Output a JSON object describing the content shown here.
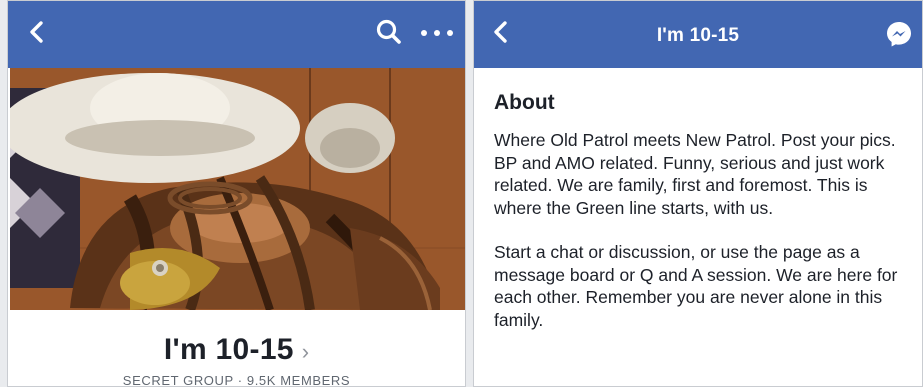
{
  "left_screen": {
    "navbar": {
      "back_icon": "chevron-left-icon",
      "search_icon": "search-icon",
      "more_icon": "more-horizontal-icon",
      "color": "#4267b2"
    },
    "cover_photo": {
      "subject": "saddle-photo"
    },
    "group": {
      "name": "I'm 10-15",
      "chevron": "›",
      "meta": "SECRET GROUP · 9.5K MEMBERS"
    }
  },
  "right_screen": {
    "navbar": {
      "back_icon": "chevron-left-icon",
      "title": "I'm 10-15",
      "messenger_icon": "messenger-icon",
      "color": "#4267b2"
    },
    "about": {
      "heading": "About",
      "paragraphs": [
        "Where Old Patrol meets New Patrol. Post your pics. BP and AMO related. Funny, serious and just work related. We are family, first and foremost. This is where the Green line starts, with us.",
        "Start a chat or discussion, or use the page as a message board or Q and A session. We are here for each other. Remember you are never alone in this family."
      ]
    }
  }
}
